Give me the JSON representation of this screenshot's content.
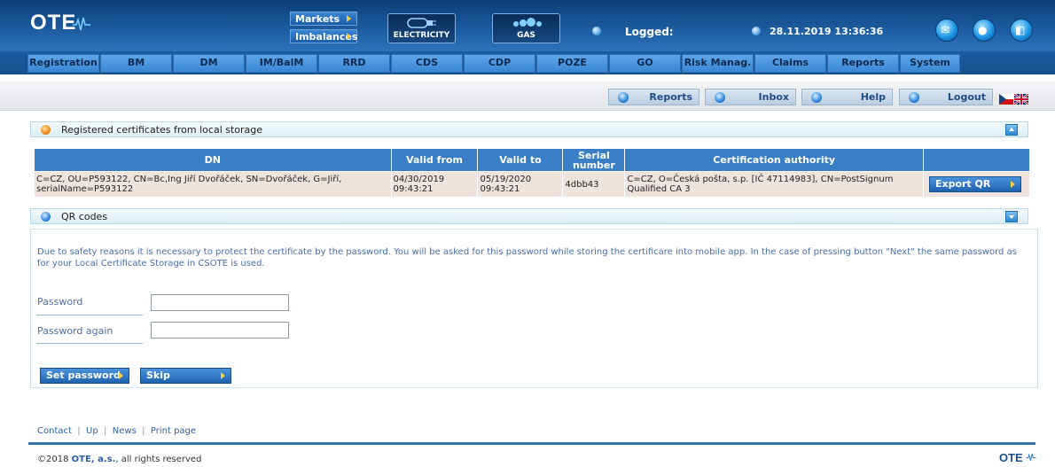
{
  "header": {
    "logo_text": "OTE",
    "markets_label": "Markets",
    "imbalances_label": "Imbalances",
    "electricity_label": "ELECTRICITY",
    "gas_label": "GAS",
    "logged_label": "Logged:",
    "datetime": "28.11.2019 13:36:36",
    "icons": [
      "mail-icon",
      "chat-icon",
      "settings-icon"
    ]
  },
  "nav": {
    "items": [
      "Registration",
      "BM",
      "DM",
      "IM/BalM",
      "RRD",
      "CDS",
      "CDP",
      "POZE",
      "GO",
      "Risk Manag.",
      "Claims",
      "Reports",
      "System"
    ]
  },
  "subnav": {
    "reports": "Reports",
    "inbox": "Inbox",
    "help": "Help",
    "logout": "Logout"
  },
  "certificates_panel": {
    "title": "Registered certificates from local storage",
    "columns": [
      "DN",
      "Valid from",
      "Valid to",
      "Serial number",
      "Certification authority"
    ],
    "rows": [
      {
        "dn": "C=CZ, OU=P593122, CN=Bc,Ing Jiří Dvořáček, SN=Dvořáček, G=Jiří, serialName=P593122",
        "valid_from": "04/30/2019 09:43:21",
        "valid_to": "05/19/2020 09:43:21",
        "serial": "4dbb43",
        "authority": "C=CZ, O=Česká pošta, s.p. [IČ 47114983], CN=PostSignum Qualified CA 3",
        "action": "Export QR"
      }
    ]
  },
  "qr_panel": {
    "title": "QR codes",
    "info": "Due to safety reasons it is necessary to protect the certificate by the password. You will be asked for this password while storing the certificare into mobile app. In the case of pressing button \"Next\" the same password as for your Local Certificate Storage in CSOTE is used.",
    "password_label": "Password",
    "password_again_label": "Password again",
    "password_value": "",
    "password_again_value": "",
    "set_password": "Set password",
    "skip": "Skip"
  },
  "footer": {
    "links": [
      "Contact",
      "Up",
      "News",
      "Print page"
    ],
    "copyright_prefix": "©2018 ",
    "company": "OTE, a.s.",
    "copyright_suffix": ", all rights reserved",
    "logo_text": "OTE"
  },
  "colors": {
    "header_blue": "#1b5b9e",
    "nav_item": "#5ea6ea",
    "table_head": "#3a7fc6",
    "table_row": "#efe3de",
    "accent_yellow": "#f4d03f"
  }
}
